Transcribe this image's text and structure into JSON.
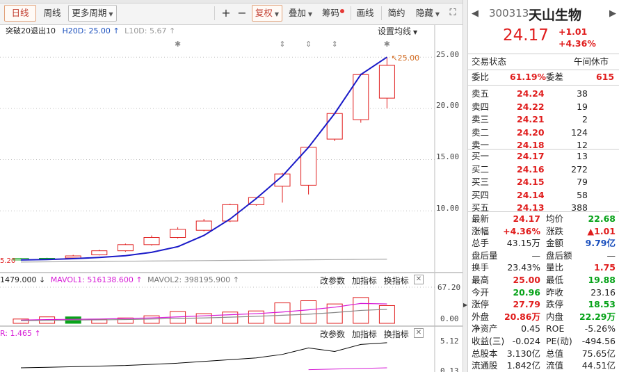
{
  "toolbar": {
    "daily": "日线",
    "weekly": "周线",
    "more_periods": "更多周期",
    "plus": "+",
    "minus": "−",
    "restore_rights": "复权",
    "overlay": "叠加",
    "chips": "筹码",
    "draw_line": "画线",
    "minimal": "简约",
    "hide": "隐藏"
  },
  "main_chart": {
    "strategy_label": "突破20退出10",
    "h20d_label": "H20D: 25.00",
    "l10d_label": "L10D: 5.67",
    "settings_label": "设置均线",
    "y_ticks": [
      "25.00",
      "20.00",
      "15.00",
      "10.00"
    ],
    "peak_label": "25.00",
    "left_low_label": "5.20",
    "candles": [
      {
        "o": 5.35,
        "c": 5.2,
        "h": 5.4,
        "l": 5.15
      },
      {
        "o": 5.36,
        "c": 5.3,
        "h": 5.42,
        "l": 5.25
      },
      {
        "o": 5.4,
        "c": 5.6,
        "h": 5.7,
        "l": 5.35
      },
      {
        "o": 5.7,
        "c": 6.1,
        "h": 6.2,
        "l": 5.65
      },
      {
        "o": 6.1,
        "c": 6.7,
        "h": 6.8,
        "l": 6.0
      },
      {
        "o": 6.7,
        "c": 7.4,
        "h": 7.6,
        "l": 6.6
      },
      {
        "o": 7.4,
        "c": 8.2,
        "h": 8.4,
        "l": 7.3
      },
      {
        "o": 8.1,
        "c": 9.0,
        "h": 9.2,
        "l": 8.0
      },
      {
        "o": 9.0,
        "c": 10.6,
        "h": 10.7,
        "l": 8.9
      },
      {
        "o": 10.6,
        "c": 11.3,
        "h": 11.3,
        "l": 10.5
      },
      {
        "o": 12.4,
        "c": 13.6,
        "h": 13.7,
        "l": 10.8
      },
      {
        "o": 12.5,
        "c": 16.2,
        "h": 16.3,
        "l": 11.6
      },
      {
        "o": 17.0,
        "c": 19.5,
        "h": 19.6,
        "l": 16.8
      },
      {
        "o": 18.9,
        "c": 23.3,
        "h": 23.4,
        "l": 18.6
      },
      {
        "o": 21.0,
        "c": 24.2,
        "h": 25.0,
        "l": 20.0
      }
    ],
    "h20d_line": [
      5.2,
      5.25,
      5.33,
      5.45,
      5.62,
      5.95,
      6.5,
      7.6,
      9.2,
      11.2,
      13.4,
      16.2,
      19.5,
      23.3,
      25.0
    ],
    "baseline": [
      5.0,
      5.02,
      5.04,
      5.06,
      5.08,
      5.1,
      5.12,
      5.14,
      5.16,
      5.18,
      5.2,
      5.22,
      5.24,
      5.26,
      5.28
    ],
    "signal_marks": [
      {
        "index": 6,
        "symbol": "✱"
      },
      {
        "index": 10,
        "symbol": "⇕"
      },
      {
        "index": 11,
        "symbol": "⇕"
      },
      {
        "index": 12,
        "symbol": "⇕"
      },
      {
        "index": 14,
        "symbol": "✱"
      }
    ]
  },
  "volume_chart": {
    "vol_label": "1479.000",
    "mavol1_label": "MAVOL1: 516138.600",
    "mavol2_label": "MAVOL2: 398195.900",
    "change_params": "改参数",
    "add_indicator": "加指标",
    "switch_indicator": "换指标",
    "y_top": "67.20",
    "y_bottom": "0.00",
    "bars": [
      {
        "v": 8,
        "up": true
      },
      {
        "v": 12,
        "up": true
      },
      {
        "v": 12,
        "up": false
      },
      {
        "v": 7,
        "up": true
      },
      {
        "v": 10,
        "up": true
      },
      {
        "v": 14,
        "up": true
      },
      {
        "v": 22,
        "up": true
      },
      {
        "v": 18,
        "up": true
      },
      {
        "v": 21,
        "up": true
      },
      {
        "v": 23,
        "up": true
      },
      {
        "v": 38,
        "up": true
      },
      {
        "v": 42,
        "up": true
      },
      {
        "v": 36,
        "up": true
      },
      {
        "v": 48,
        "up": true
      },
      {
        "v": 33,
        "up": true
      }
    ],
    "mavol1": [
      6,
      7,
      7.5,
      8,
      9,
      10,
      12,
      14,
      16,
      18,
      21,
      25,
      30,
      37,
      36
    ],
    "mavol2": [
      5,
      5.5,
      6,
      6.5,
      7,
      8,
      9,
      10,
      11.5,
      13,
      15,
      17,
      20,
      24,
      26
    ]
  },
  "indicator_chart": {
    "label": "R: 1.465",
    "change_params": "改参数",
    "add_indicator": "加指标",
    "switch_indicator": "换指标",
    "y_top": "5.12",
    "y_bottom": "0.13",
    "line1": [
      0.6,
      0.7,
      0.8,
      0.9,
      1.0,
      1.2,
      1.4,
      1.7,
      2.0,
      2.3,
      2.9,
      4.0,
      3.4,
      4.6,
      4.9
    ],
    "line2": [
      null,
      null,
      null,
      null,
      null,
      null,
      null,
      null,
      null,
      null,
      null,
      0.3,
      0.4,
      0.5,
      0.6
    ]
  },
  "quote": {
    "code": "300313",
    "name": "天山生物",
    "price": "24.17",
    "change": "+1.01",
    "change_pct": "+4.36%",
    "trade_status_label": "交易状态",
    "trade_status_value": "午间休市",
    "weibi_label": "委比",
    "weibi_value": "61.19%",
    "weicha_label": "委差",
    "weicha_value": "615",
    "asks": [
      {
        "label": "卖五",
        "price": "24.24",
        "vol": "38"
      },
      {
        "label": "卖四",
        "price": "24.22",
        "vol": "19"
      },
      {
        "label": "卖三",
        "price": "24.21",
        "vol": "2"
      },
      {
        "label": "卖二",
        "price": "24.20",
        "vol": "124"
      },
      {
        "label": "卖一",
        "price": "24.18",
        "vol": "12"
      }
    ],
    "bids": [
      {
        "label": "买一",
        "price": "24.17",
        "vol": "13"
      },
      {
        "label": "买二",
        "price": "24.16",
        "vol": "272"
      },
      {
        "label": "买三",
        "price": "24.15",
        "vol": "79"
      },
      {
        "label": "买四",
        "price": "24.14",
        "vol": "58"
      },
      {
        "label": "买五",
        "price": "24.13",
        "vol": "388"
      }
    ],
    "stats": [
      {
        "l1": "最新",
        "v1": "24.17",
        "c1": "red",
        "l2": "均价",
        "v2": "22.68",
        "c2": "green"
      },
      {
        "l1": "涨幅",
        "v1": "+4.36%",
        "c1": "red",
        "l2": "涨跌",
        "v2": "▲1.01",
        "c2": "red"
      },
      {
        "l1": "总手",
        "v1": "43.15万",
        "c1": "",
        "l2": "金额",
        "v2": "9.79亿",
        "c2": "blue"
      },
      {
        "l1": "盘后量",
        "v1": "—",
        "c1": "",
        "l2": "盘后额",
        "v2": "—",
        "c2": ""
      },
      {
        "l1": "换手",
        "v1": "23.43%",
        "c1": "",
        "l2": "量比",
        "v2": "1.75",
        "c2": "red"
      },
      {
        "l1": "最高",
        "v1": "25.00",
        "c1": "red",
        "l2": "最低",
        "v2": "19.88",
        "c2": "green"
      },
      {
        "l1": "今开",
        "v1": "20.96",
        "c1": "green",
        "l2": "昨收",
        "v2": "23.16",
        "c2": ""
      },
      {
        "l1": "涨停",
        "v1": "27.79",
        "c1": "red",
        "l2": "跌停",
        "v2": "18.53",
        "c2": "green"
      },
      {
        "l1": "外盘",
        "v1": "20.86万",
        "c1": "red",
        "l2": "内盘",
        "v2": "22.29万",
        "c2": "green"
      },
      {
        "l1": "净资产",
        "v1": "0.45",
        "c1": "",
        "l2": "ROE",
        "v2": "-5.26%",
        "c2": ""
      },
      {
        "l1": "收益(三)",
        "v1": "-0.024",
        "c1": "",
        "l2": "PE(动)",
        "v2": "-494.56",
        "c2": ""
      },
      {
        "l1": "总股本",
        "v1": "3.130亿",
        "c1": "",
        "l2": "总值",
        "v2": "75.65亿",
        "c2": ""
      },
      {
        "l1": "流通股",
        "v1": "1.842亿",
        "c1": "",
        "l2": "流值",
        "v2": "44.51亿",
        "c2": ""
      }
    ]
  },
  "colors": {
    "up": "#e01d1d",
    "down": "#08a31a",
    "h20d_line": "#1a1ac8",
    "mavol1": "#d61ad6",
    "mavol2": "#888888",
    "indicator": "#000000",
    "indicator2": "#d61ad6",
    "peak_label": "#d2691e"
  }
}
